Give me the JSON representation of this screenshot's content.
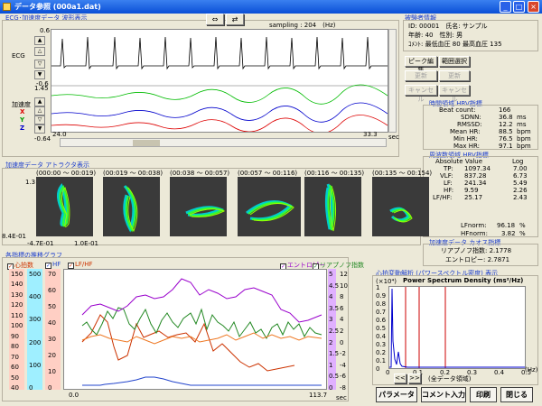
{
  "window": {
    "title": "データ参照 (000a1.dat)"
  },
  "ecg_section": {
    "title": "ECG･加速度データ 波形表示",
    "sampling_label": "sampling : 204　(Hz)",
    "ecg_label": "ECG",
    "accel_label": "加速度",
    "axis_x": "X",
    "axis_y": "Y",
    "axis_z": "Z",
    "ecg_y_top": "0.6",
    "ecg_y_bottom": "-0.6",
    "acc_y_top": "1.45",
    "acc_y_bottom": "-0.64",
    "time_start": "24.0",
    "time_end": "33.3",
    "time_unit": "sec"
  },
  "subject": {
    "title": "被験者情報",
    "line1": "ID: 00001　氏名: サンプル",
    "line2": "年齢: 40　性別: 男",
    "line3": "ｺﾒﾝﾄ: 最低血圧 80  最高血圧 135"
  },
  "peak_buttons": {
    "peak_edit": "ピーク編集",
    "range_select": "範囲選択",
    "update1": "更新",
    "update2": "更新",
    "cancel1": "キャンセル",
    "cancel2": "キャンセル"
  },
  "time_hrv": {
    "title": "時間領域 HRV指標",
    "rows": [
      {
        "label": "Beat count:",
        "value": "166",
        "unit": ""
      },
      {
        "label": "SDNN:",
        "value": "36.8",
        "unit": "ms"
      },
      {
        "label": "RMSSD:",
        "value": "12.2",
        "unit": "ms"
      },
      {
        "label": "Mean HR:",
        "value": "88.5",
        "unit": "bpm"
      },
      {
        "label": "Min HR:",
        "value": "76.5",
        "unit": "bpm"
      },
      {
        "label": "Max HR:",
        "value": "97.1",
        "unit": "bpm"
      }
    ]
  },
  "freq_hrv": {
    "title": "周波数領域 HRV指標",
    "col1": "Absolute Value",
    "col2": "Log",
    "rows": [
      {
        "label": "TP:",
        "abs": "1097.34",
        "log": "7.00"
      },
      {
        "label": "VLF:",
        "abs": "837.28",
        "log": "6.73"
      },
      {
        "label": "LF:",
        "abs": "241.34",
        "log": "5.49"
      },
      {
        "label": "HF:",
        "abs": "9.59",
        "log": "2.26"
      },
      {
        "label": "LF/HF:",
        "abs": "25.17",
        "log": "2.43"
      }
    ],
    "lfnorm_label": "LFnorm:",
    "lfnorm": "96.18",
    "lfnorm_unit": "%",
    "hfnorm_label": "HFnorm:",
    "hfnorm": "3.82",
    "hfnorm_unit": "%"
  },
  "chaos": {
    "title": "加速度データ カオス指標",
    "line1": "リアプノフ指数: 2.1778",
    "line2": "エントロピー: 2.7871"
  },
  "attractor": {
    "title": "加速度データ アトラクタ表示",
    "ranges": [
      "(000:00 ～ 00:019)",
      "(00:019 ～ 00:038)",
      "(00:038 ～ 00:057)",
      "(00:057 ～ 00:116)",
      "(00:116 ～ 00:135)",
      "(00:135 ～ 00:154)"
    ],
    "y_top": "1.3",
    "y_bottom": "8.4E-01",
    "x_left": "-4.7E-01",
    "x_right": "1.0E-01"
  },
  "trend": {
    "title": "各指標の推移グラフ",
    "cb_hr": "心拍数",
    "cb_hf": "HF",
    "cb_lfhf": "LF/HF",
    "cb_entropy": "エントロピー",
    "cb_lyap": "リアプノフ指数",
    "hr_ticks": [
      "150",
      "140",
      "130",
      "120",
      "110",
      "100",
      "90",
      "80",
      "70",
      "60",
      "50",
      "40"
    ],
    "hf_ticks": [
      "500",
      "400",
      "300",
      "200",
      "100",
      "0"
    ],
    "lfhf_ticks": [
      "70",
      "60",
      "50",
      "40",
      "30",
      "20",
      "10",
      "0"
    ],
    "ent_ticks": [
      "5",
      "4.5",
      "4",
      "3.5",
      "3",
      "2.5",
      "2",
      "1.5",
      "1",
      "0.5",
      "0"
    ],
    "lyap_ticks": [
      "12",
      "10",
      "8",
      "6",
      "4",
      "2",
      "0",
      "-2",
      "-4",
      "-6",
      "-8"
    ],
    "x_start": "0.0",
    "x_end": "113.7",
    "x_unit": "sec",
    "colors": {
      "hr": "#cc3300",
      "hf": "#2244cc",
      "lfhf": "#228822",
      "entropy": "#9900cc",
      "lyap": "#ee7722"
    }
  },
  "psd": {
    "title": "心拍変動解析 (パワースペクトル密度) 表示",
    "chart_title": "Power Spectrum Density (ms²/Hz)",
    "exponent": "(×10⁴)",
    "y_ticks": [
      "1",
      "0.9",
      "0.8",
      "0.7",
      "0.6",
      "0.5",
      "0.4",
      "0.3",
      "0.2",
      "0.1",
      "0"
    ],
    "x_ticks": [
      "0",
      "0.1",
      "0.2",
      "0.3",
      "0.4",
      "0.5"
    ],
    "x_unit": "(Hz)",
    "prev_btn": "<<",
    "next_btn": ">>",
    "range_label": "(全データ領域)"
  },
  "bottom_buttons": {
    "parameter": "パラメータ",
    "comment": "コメント入力",
    "print": "印刷",
    "close": "閉じる"
  }
}
